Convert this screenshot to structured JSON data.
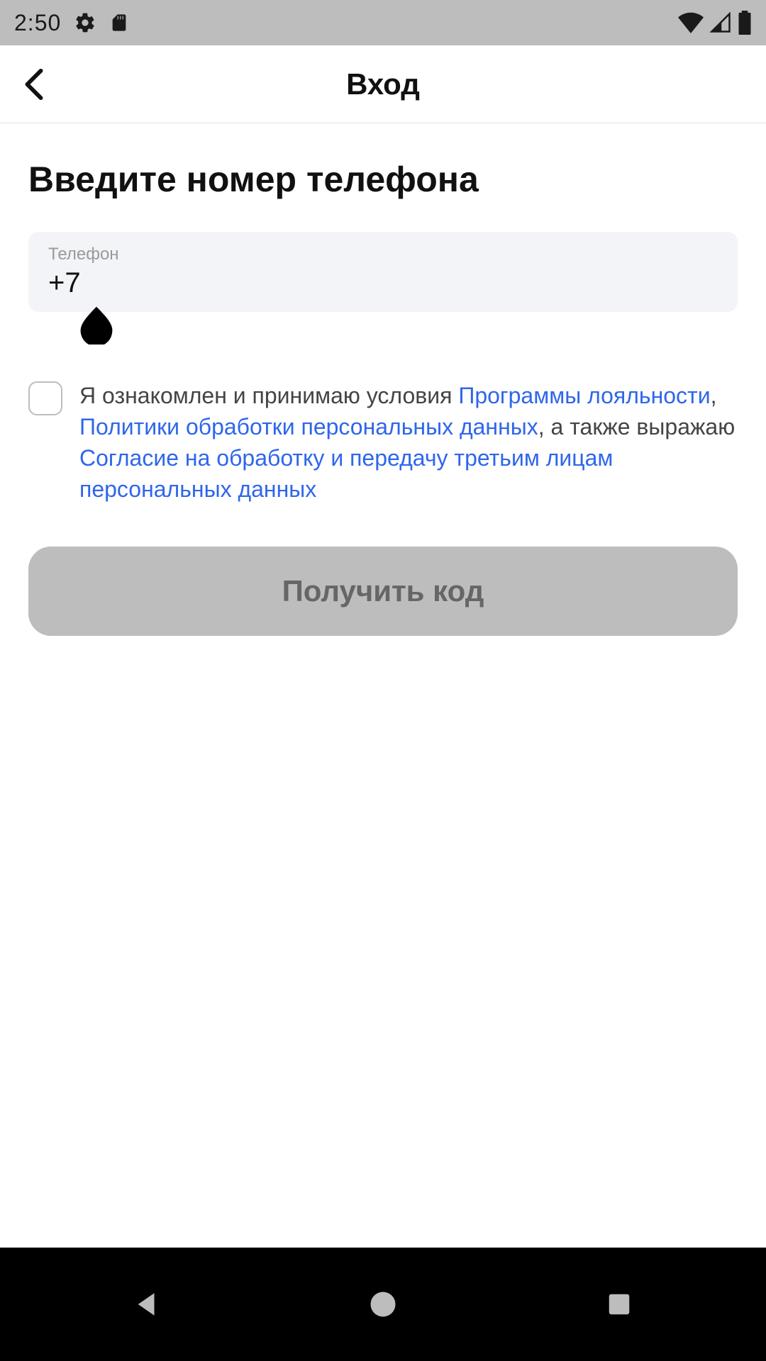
{
  "status": {
    "time": "2:50"
  },
  "header": {
    "title": "Вход"
  },
  "main": {
    "prompt": "Введите номер телефона",
    "phone_label": "Телефон",
    "phone_value": "+7"
  },
  "consent": {
    "t1": "Я ознакомлен и принимаю условия ",
    "link1": "Программы лояльности",
    "sep1": ", ",
    "link2": "Политики обработки персональных данных",
    "sep2": ", а также выражаю ",
    "link3": "Согласие на обработку и передачу третьим лицам персональных данных"
  },
  "button": {
    "label": "Получить код"
  }
}
